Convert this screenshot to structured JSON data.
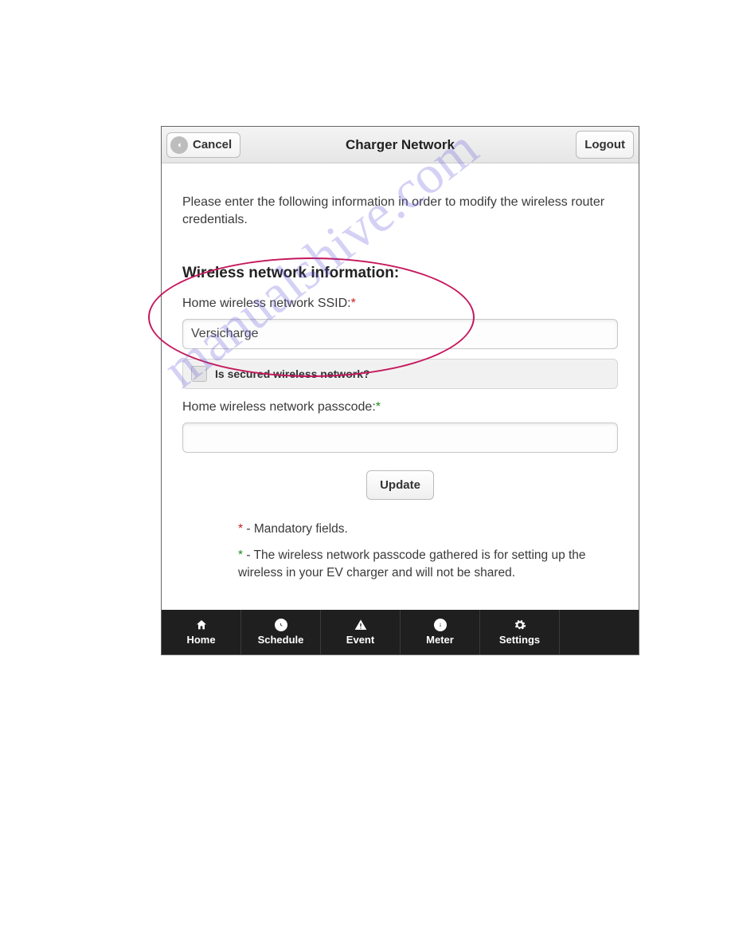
{
  "header": {
    "cancel_label": "Cancel",
    "title": "Charger Network",
    "logout_label": "Logout"
  },
  "intro_text": "Please enter the following information in order to modify the wireless router credentials.",
  "section_heading": "Wireless network information:",
  "ssid": {
    "label": "Home wireless network SSID:",
    "required_marker": "*",
    "value": "Versicharge"
  },
  "secured_checkbox": {
    "label": "Is secured wireless network?",
    "checked": false
  },
  "passcode": {
    "label": "Home wireless network passcode:",
    "required_marker": "*",
    "value": ""
  },
  "update_button_label": "Update",
  "notes": {
    "mandatory_star": "*",
    "mandatory_text": " - Mandatory fields.",
    "passcode_star": "*",
    "passcode_text": " - The wireless network passcode gathered is for setting up the wireless in your EV charger and will not be shared."
  },
  "bottom_nav": {
    "home": "Home",
    "schedule": "Schedule",
    "event": "Event",
    "meter": "Meter",
    "settings": "Settings"
  },
  "watermark_text": "manualshive.com"
}
